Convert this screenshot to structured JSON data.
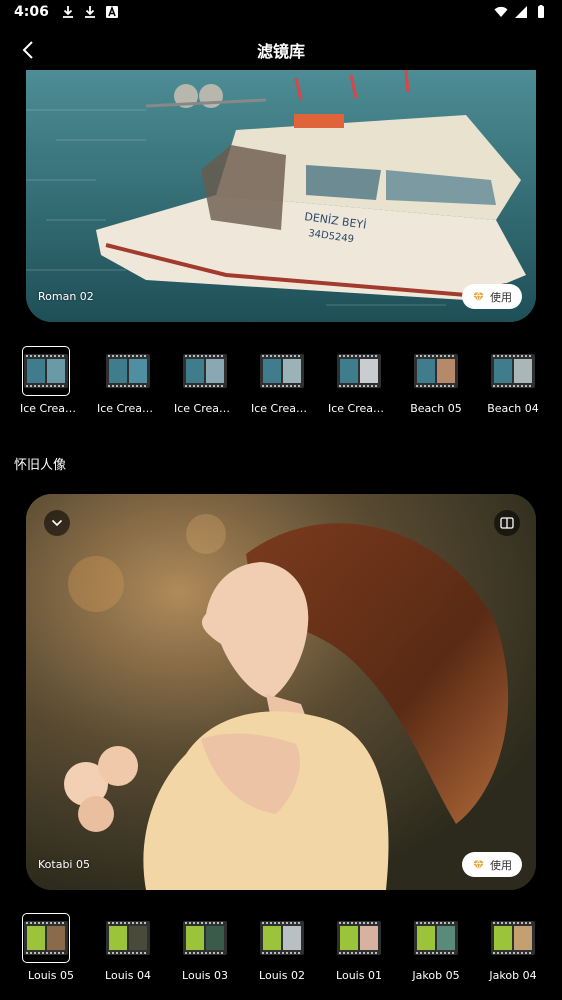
{
  "status_bar": {
    "time": "4:06",
    "left_icons": [
      "download-icon",
      "download-icon",
      "text-a-icon"
    ],
    "right_icons": [
      "wifi-icon",
      "signal-icon",
      "battery-icon"
    ]
  },
  "app_bar": {
    "title": "滤镜库",
    "back_icon": "chevron-left-icon"
  },
  "preview_1": {
    "label": "Roman 02",
    "use_label": "使用"
  },
  "row_1": {
    "selected_index": 0,
    "items": [
      {
        "label": "Ice Cream..."
      },
      {
        "label": "Ice Cream..."
      },
      {
        "label": "Ice Cream..."
      },
      {
        "label": "Ice Cream..."
      },
      {
        "label": "Ice Cream..."
      },
      {
        "label": "Beach 05"
      },
      {
        "label": "Beach 04"
      }
    ]
  },
  "section_2": {
    "title": "怀旧人像"
  },
  "preview_2": {
    "label": "Kotabi 05",
    "use_label": "使用"
  },
  "row_2": {
    "selected_index": 0,
    "items": [
      {
        "label": "Louis 05"
      },
      {
        "label": "Louis 04"
      },
      {
        "label": "Louis 03"
      },
      {
        "label": "Louis 02"
      },
      {
        "label": "Louis 01"
      },
      {
        "label": "Jakob 05"
      },
      {
        "label": "Jakob 04"
      }
    ]
  },
  "colors": {
    "background": "#000000",
    "accent_gem": "#e8a33a",
    "film_strip_blue": "#3f7d8c",
    "film_strip_green": "#9cc43a"
  }
}
